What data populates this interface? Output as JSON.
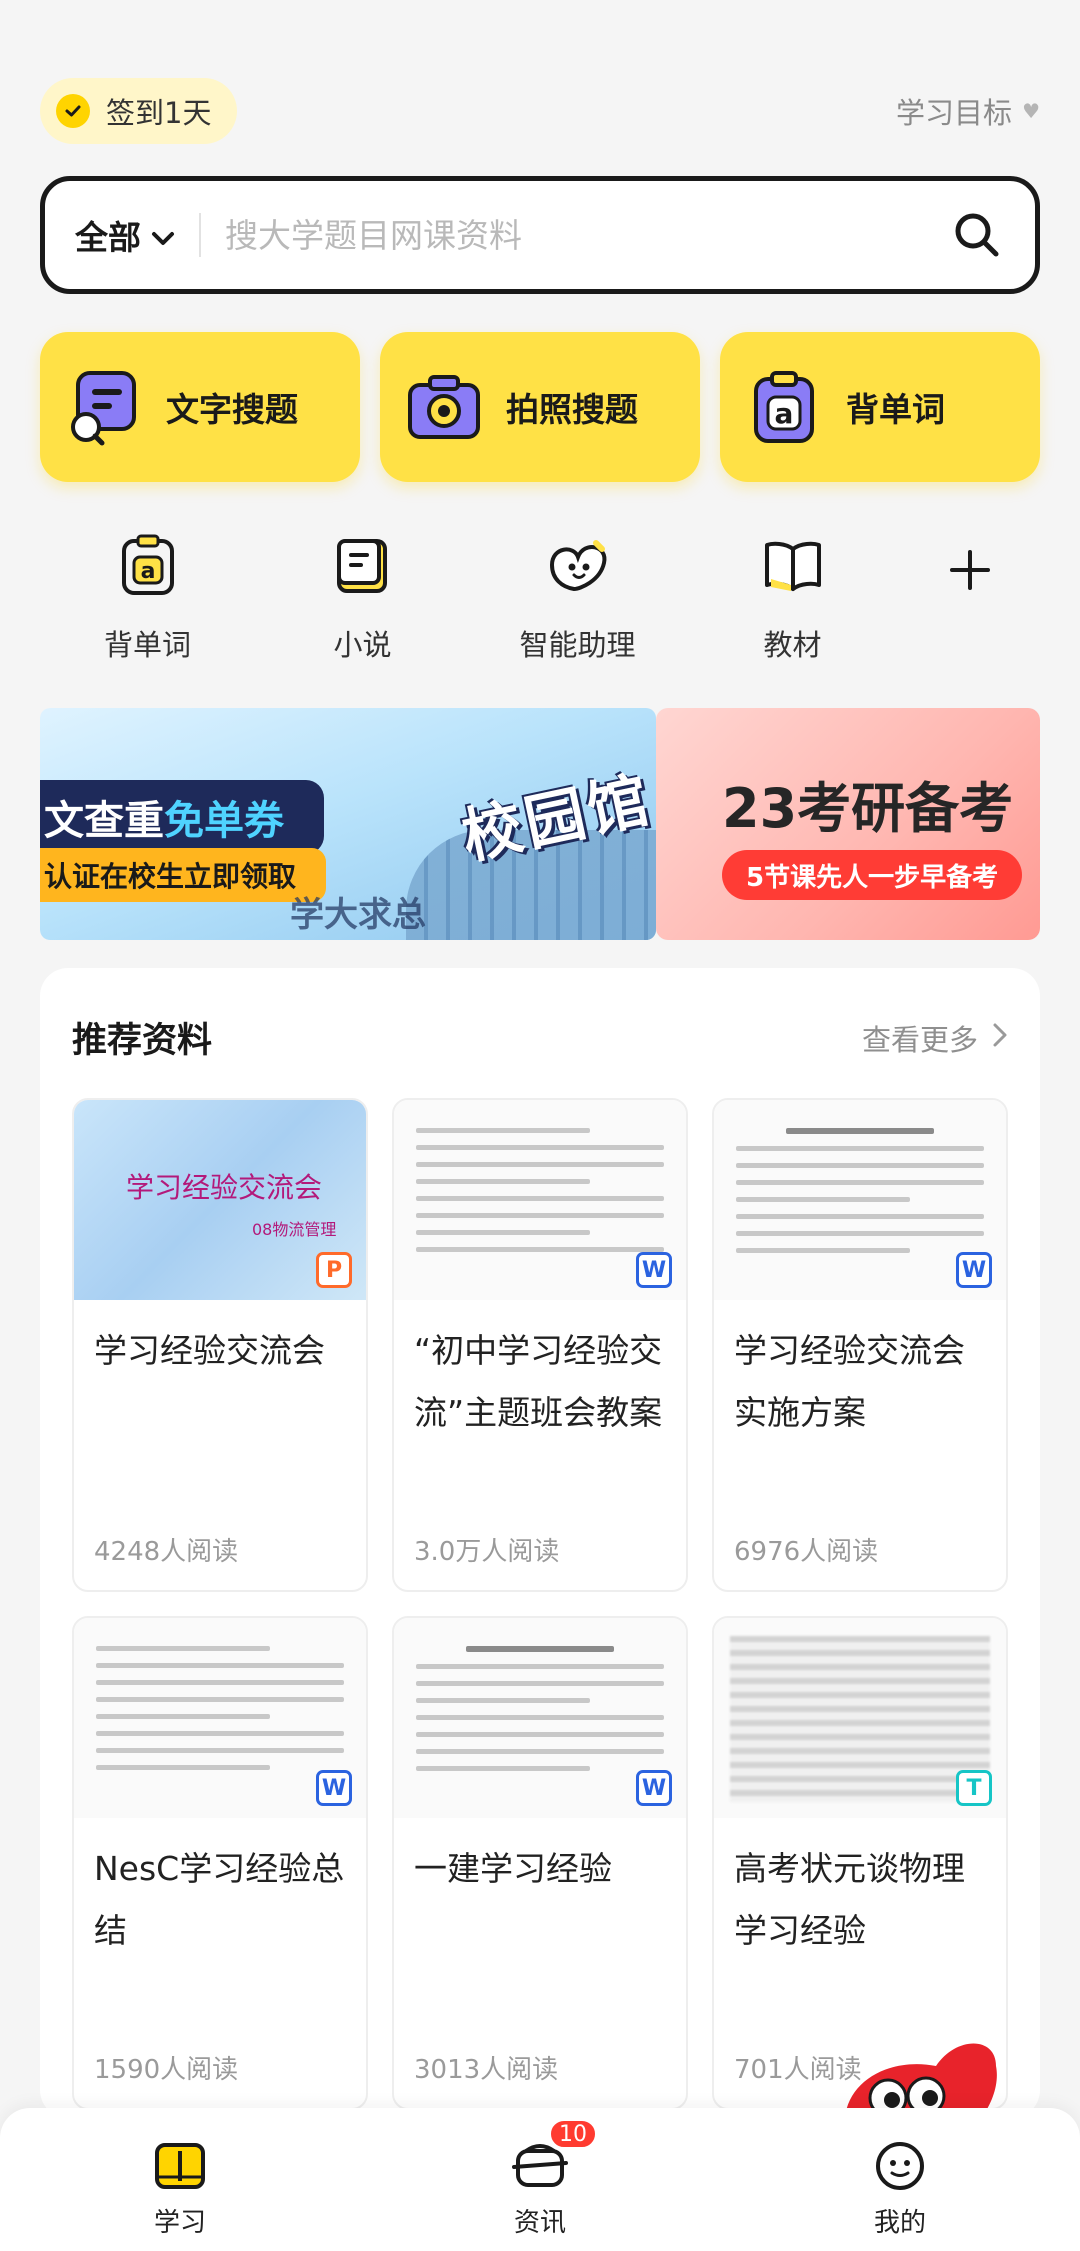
{
  "header": {
    "checkin_label": "签到1天",
    "goal_label": "学习目标"
  },
  "search": {
    "scope": "全部",
    "placeholder": "搜大学题目网课资料"
  },
  "actions": [
    {
      "label": "文字搜题",
      "icon": "text-search-icon"
    },
    {
      "label": "拍照搜题",
      "icon": "camera-icon"
    },
    {
      "label": "背单词",
      "icon": "vocab-card-icon"
    }
  ],
  "quick": [
    {
      "label": "背单词",
      "icon": "vocab-icon"
    },
    {
      "label": "小说",
      "icon": "novel-icon"
    },
    {
      "label": "智能助理",
      "icon": "assistant-icon"
    },
    {
      "label": "教材",
      "icon": "textbook-icon"
    }
  ],
  "banners": {
    "b1_line1_a": "文查重",
    "b1_line1_b": "免单券",
    "b1_line2": "认证在校生立即领取",
    "b1_school": "校园馆",
    "b1_motto": "学大求总",
    "b2_title": "23考研备考",
    "b2_sub": "5节课先人一步早备考"
  },
  "recommend": {
    "title": "推荐资料",
    "more": "查看更多",
    "items": [
      {
        "title": "学习经验交流会",
        "reads": "4248人阅读",
        "type": "P",
        "thumb_title": "学习经验交流会",
        "thumb_sub": "08物流管理"
      },
      {
        "title": "“初中学习经验交流”主题班会教案",
        "reads": "3.0万人阅读",
        "type": "W"
      },
      {
        "title": "学习经验交流会实施方案",
        "reads": "6976人阅读",
        "type": "W"
      },
      {
        "title": "NesC学习经验总结",
        "reads": "1590人阅读",
        "type": "W"
      },
      {
        "title": "一建学习经验",
        "reads": "3013人阅读",
        "type": "W"
      },
      {
        "title": "高考状元谈物理学习经验",
        "reads": "701人阅读",
        "type": "T"
      }
    ]
  },
  "nav": {
    "items": [
      {
        "label": "学习",
        "icon": "study-book-icon"
      },
      {
        "label": "资讯",
        "icon": "news-icon",
        "badge": "10"
      },
      {
        "label": "我的",
        "icon": "profile-face-icon"
      }
    ]
  },
  "colors": {
    "accent_yellow": "#ffe146",
    "icon_purple": "#8a7cf6",
    "badge_red": "#ff3b30"
  }
}
